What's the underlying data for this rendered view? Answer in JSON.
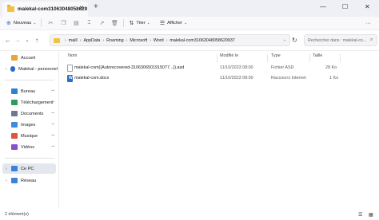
{
  "window": {
    "tab_title": "malekal-com31063048058629",
    "tab_close": "✕",
    "new_tab": "+",
    "minimize": "—",
    "maximize": "☐",
    "close": "✕"
  },
  "toolbar": {
    "new_label": "Nouveau",
    "sort_label": "Trier",
    "view_label": "Afficher",
    "more": "···",
    "icons": [
      "cut-icon",
      "copy-icon",
      "paste-icon",
      "rename-icon",
      "share-icon",
      "delete-icon"
    ]
  },
  "nav": {
    "back": "←",
    "forward": "→",
    "chevron": "⌄",
    "up": "↑"
  },
  "address": {
    "crumbs": [
      "maill",
      "AppData",
      "Roaming",
      "Microsoft",
      "Word",
      "malekal-com31063048058629937"
    ],
    "separator": "›",
    "chevron": "⌄"
  },
  "refresh": "↻",
  "search": {
    "placeholder": "Rechercher dans : malekal-co..."
  },
  "sidebar": {
    "items": [
      {
        "label": "Accueil",
        "icon": "home-icon",
        "color": "#e8a33d"
      },
      {
        "label": "Malekal - personnel",
        "icon": "onedrive-icon",
        "color": "#2b6cc4"
      },
      {
        "label": "Bureau",
        "icon": "desktop-icon",
        "color": "#2e7fd6"
      },
      {
        "label": "Téléchargement",
        "icon": "download-icon",
        "color": "#2e9c5a"
      },
      {
        "label": "Documents",
        "icon": "documents-icon",
        "color": "#6b7a8f"
      },
      {
        "label": "Images",
        "icon": "images-icon",
        "color": "#3d8be0"
      },
      {
        "label": "Musique",
        "icon": "music-icon",
        "color": "#e0543d"
      },
      {
        "label": "Vidéos",
        "icon": "videos-icon",
        "color": "#8a4fd1"
      },
      {
        "label": "Ce PC",
        "icon": "computer-icon",
        "color": "#3b83d9"
      },
      {
        "label": "Réseau",
        "icon": "network-icon",
        "color": "#3b83d9"
      }
    ],
    "pin": "📌"
  },
  "columns": {
    "name": "Nom",
    "modified": "Modifié le",
    "type": "Type",
    "size": "Taille"
  },
  "files": [
    {
      "name": "malekal-com((Autorecovered-3106306501915077...)).asd",
      "modified": "11/10/2023 08:00",
      "type": "Fichier ASD",
      "size": "28 Ko",
      "icon": "file-icon"
    },
    {
      "name": "malekal-com.docx",
      "modified": "11/10/2023 08:00",
      "type": "Raccourci Internet",
      "size": "1 Ko",
      "icon": "word-file-icon"
    }
  ],
  "status": {
    "text": "2 élément(s)",
    "view_details": "☰",
    "view_tiles": "▦"
  }
}
